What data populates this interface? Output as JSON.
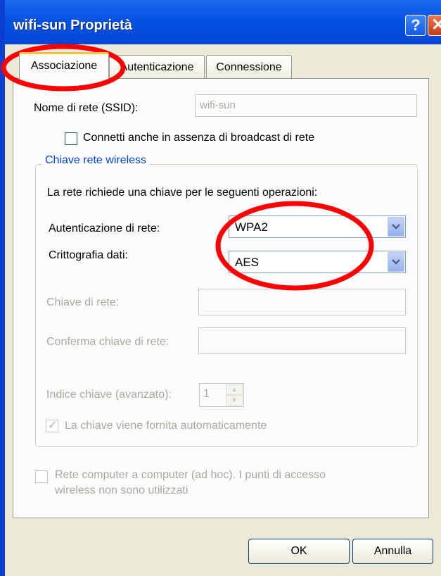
{
  "window": {
    "title": "wifi-sun Proprietà",
    "help_icon": "?",
    "close_icon": "✕"
  },
  "tabs": [
    {
      "label": "Associazione",
      "active": true
    },
    {
      "label": "Autenticazione",
      "active": false
    },
    {
      "label": "Connessione",
      "active": false
    }
  ],
  "association": {
    "ssid_label": "Nome di rete (SSID):",
    "ssid_value": "wifi-sun",
    "broadcast_checkbox_label": "Connetti anche in assenza di broadcast di rete",
    "broadcast_checked": false,
    "group_title": "Chiave rete wireless",
    "requirement_text": "La rete richiede una chiave per le seguenti operazioni:",
    "auth_label": "Autenticazione di rete:",
    "auth_value": "WPA2",
    "encryption_label": "Crittografia dati:",
    "encryption_value": "AES",
    "network_key_label": "Chiave di rete:",
    "network_key_value": "",
    "confirm_key_label": "Conferma chiave di rete:",
    "confirm_key_value": "",
    "key_index_label": "Indice chiave (avanzato):",
    "key_index_value": "1",
    "auto_key_label": "La chiave viene fornita automaticamente",
    "auto_key_checked": true,
    "adhoc_label_line1": "Rete computer a computer (ad hoc). I punti di accesso",
    "adhoc_label_line2": "wireless non sono utilizzati",
    "adhoc_checked": false
  },
  "buttons": {
    "ok": "OK",
    "cancel": "Annulla"
  },
  "colors": {
    "title_bar": "#0553e3",
    "dialog_bg": "#ece9d8",
    "annotation_red": "#ff0000",
    "group_title": "#0046d5"
  }
}
